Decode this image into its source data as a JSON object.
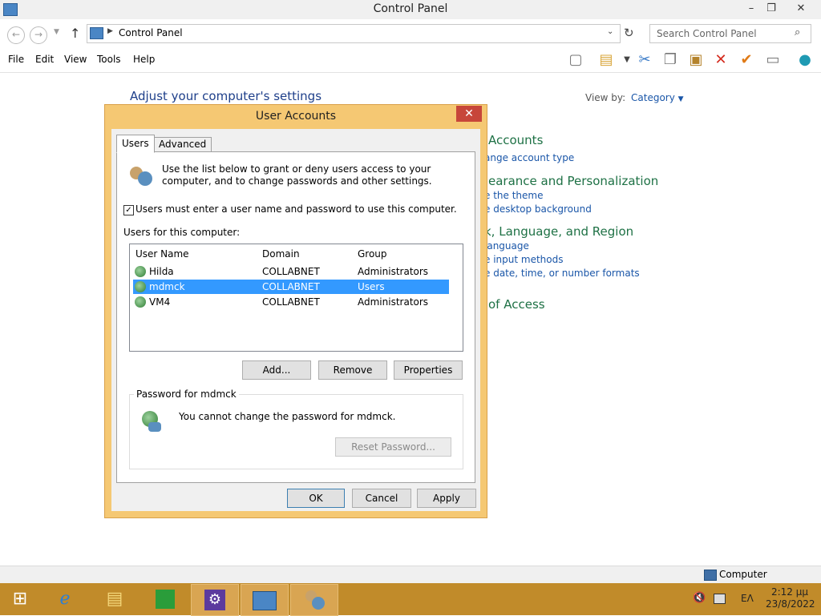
{
  "window": {
    "title": "Control Panel",
    "controls": {
      "minimize": "–",
      "maximize": "❐",
      "close": "✕"
    }
  },
  "address": {
    "breadcrumb": "Control Panel",
    "search_placeholder": "Search Control Panel"
  },
  "menu": [
    "File",
    "Edit",
    "View",
    "Tools",
    "Help"
  ],
  "control_panel": {
    "heading": "Adjust your computer's settings",
    "view_by_label": "View by:",
    "view_by_value": "Category",
    "categories": [
      {
        "title": "Accounts",
        "links": [
          "ange account type"
        ]
      },
      {
        "title": "earance and Personalization",
        "links": [
          "e the theme",
          "e desktop background"
        ]
      },
      {
        "title": "k, Language, and Region",
        "links": [
          "language",
          "e input methods",
          "e date, time, or number formats"
        ]
      },
      {
        "title": "of Access",
        "links": []
      }
    ]
  },
  "dialog": {
    "title": "User Accounts",
    "close": "✕",
    "tabs": [
      "Users",
      "Advanced"
    ],
    "intro": "Use the list below to grant or deny users access to your computer, and to change passwords and other settings.",
    "must_login_label": "Users must enter a user name and password to use this computer.",
    "must_login_checked": true,
    "list_label": "Users for this computer:",
    "columns": [
      "User Name",
      "Domain",
      "Group"
    ],
    "users": [
      {
        "name": "Hilda",
        "domain": "COLLABNET",
        "group": "Administrators"
      },
      {
        "name": "mdmck",
        "domain": "COLLABNET",
        "group": "Users"
      },
      {
        "name": "VM4",
        "domain": "COLLABNET",
        "group": "Administrators"
      }
    ],
    "list_buttons": {
      "add": "Add...",
      "remove": "Remove",
      "properties": "Properties"
    },
    "password_group": "Password for mdmck",
    "password_message": "You cannot change the password for mdmck.",
    "reset_password": "Reset Password...",
    "footer": {
      "ok": "OK",
      "cancel": "Cancel",
      "apply": "Apply"
    }
  },
  "statusbar": {
    "computer": "Computer"
  },
  "taskbar": {
    "lang": "ΕΛ",
    "time": "2:12 μμ",
    "date": "23/8/2022"
  }
}
